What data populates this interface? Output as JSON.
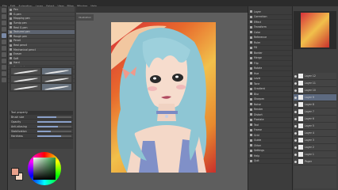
{
  "menu": [
    "File",
    "Edit",
    "Animation",
    "Layer",
    "Select",
    "View",
    "Filter",
    "Window",
    "Help"
  ],
  "canvas_tab": "Illustration",
  "subtool": {
    "items": [
      "Pen",
      "G-pen",
      "Mapping pen",
      "Turnip pen",
      "Real G-pen",
      "Textured pen",
      "Rough pen",
      "Pencil",
      "Real pencil",
      "Mechanical pencil",
      "Eraser",
      "Soft",
      "Hard",
      "Kneaded eraser",
      "Brush",
      "Watercolor",
      "Oil paint"
    ],
    "selected_index": 5
  },
  "tool_property": {
    "title": "Tool property",
    "rows": [
      {
        "label": "Brush size",
        "level": 0.55
      },
      {
        "label": "Opacity",
        "level": 1.0
      },
      {
        "label": "Anti-aliasing",
        "level": 0.6
      },
      {
        "label": "Stabilization",
        "level": 0.4
      },
      {
        "label": "Hardness",
        "level": 0.7
      }
    ]
  },
  "colors": {
    "main": "#e8a08a",
    "sub": "#f4d6c2",
    "accent": "#5d6a80"
  },
  "right_mid_items": [
    "Layer",
    "Correction",
    "Effect",
    "Transform",
    "Color",
    "Reference",
    "Ruler",
    "Fill",
    "Border",
    "Merge",
    "Flip",
    "Rotate",
    "Hue",
    "Level",
    "Tone",
    "Gradient",
    "Blur",
    "Sharpen",
    "Noise",
    "Render",
    "Distort",
    "Pixelate",
    "Text",
    "Frame",
    "Grid",
    "Guide",
    "Other",
    "Settings",
    "Help",
    "Quit"
  ],
  "layers": {
    "items": [
      "Layer 12",
      "Layer 11",
      "Layer 10",
      "Layer 9",
      "Layer 8",
      "Layer 7",
      "Layer 6",
      "Layer 5",
      "Layer 4",
      "Layer 3",
      "Layer 2",
      "Layer 1",
      "Paper"
    ],
    "selected_index": 3
  }
}
